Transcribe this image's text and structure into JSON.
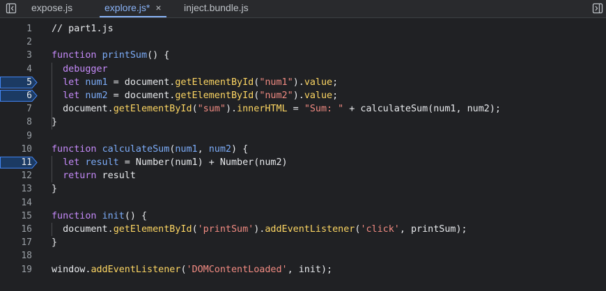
{
  "tabs": [
    {
      "label": "expose.js",
      "active": false
    },
    {
      "label": "explore.js*",
      "active": true,
      "close": "×"
    },
    {
      "label": "inject.bundle.js",
      "active": false
    }
  ],
  "colors": {
    "background": "#202124",
    "keyword": "#c58af9",
    "function": "#7cacf8",
    "property": "#fdd663",
    "string": "#f28b82",
    "breakpoint": "#1a73e8",
    "active_tab": "#8ab4f8"
  },
  "breakpoints": [
    5,
    6,
    11
  ],
  "lines": [
    {
      "n": "1",
      "t": [
        [
          "// part1.js",
          "cm"
        ]
      ]
    },
    {
      "n": "2",
      "t": []
    },
    {
      "n": "3",
      "t": [
        [
          "function",
          "kw"
        ],
        [
          " ",
          ""
        ],
        [
          "printSum",
          "fn"
        ],
        [
          "() {",
          ""
        ]
      ]
    },
    {
      "n": "4",
      "t": [
        [
          "  ",
          ""
        ],
        [
          "debugger",
          "kw"
        ]
      ]
    },
    {
      "n": "5",
      "t": [
        [
          "  ",
          ""
        ],
        [
          "let",
          "kw"
        ],
        [
          " ",
          ""
        ],
        [
          "num1",
          "var"
        ],
        [
          " = document.",
          ""
        ],
        [
          "getElementById",
          "prop"
        ],
        [
          "(",
          ""
        ],
        [
          "\"num1\"",
          "str"
        ],
        [
          ").",
          ""
        ],
        [
          "value",
          "prop"
        ],
        [
          ";",
          ""
        ]
      ]
    },
    {
      "n": "6",
      "t": [
        [
          "  ",
          ""
        ],
        [
          "let",
          "kw"
        ],
        [
          " ",
          ""
        ],
        [
          "num2",
          "var"
        ],
        [
          " = document.",
          ""
        ],
        [
          "getElementById",
          "prop"
        ],
        [
          "(",
          ""
        ],
        [
          "\"num2\"",
          "str"
        ],
        [
          ").",
          ""
        ],
        [
          "value",
          "prop"
        ],
        [
          ";",
          ""
        ]
      ]
    },
    {
      "n": "7",
      "t": [
        [
          "  document.",
          ""
        ],
        [
          "getElementById",
          "prop"
        ],
        [
          "(",
          ""
        ],
        [
          "\"sum\"",
          "str"
        ],
        [
          ").",
          ""
        ],
        [
          "innerHTML",
          "prop"
        ],
        [
          " = ",
          ""
        ],
        [
          "\"Sum: \"",
          "str"
        ],
        [
          " + calculateSum(num1, num2);",
          ""
        ]
      ]
    },
    {
      "n": "8",
      "t": [
        [
          "}",
          ""
        ]
      ]
    },
    {
      "n": "9",
      "t": []
    },
    {
      "n": "10",
      "t": [
        [
          "function",
          "kw"
        ],
        [
          " ",
          ""
        ],
        [
          "calculateSum",
          "fn"
        ],
        [
          "(",
          ""
        ],
        [
          "num1",
          "var"
        ],
        [
          ", ",
          ""
        ],
        [
          "num2",
          "var"
        ],
        [
          ") {",
          ""
        ]
      ]
    },
    {
      "n": "11",
      "t": [
        [
          "  ",
          ""
        ],
        [
          "let",
          "kw"
        ],
        [
          " ",
          ""
        ],
        [
          "result",
          "var"
        ],
        [
          " = Number(num1) + Number(num2)",
          ""
        ]
      ]
    },
    {
      "n": "12",
      "t": [
        [
          "  ",
          ""
        ],
        [
          "return",
          "kw"
        ],
        [
          " result",
          ""
        ]
      ]
    },
    {
      "n": "13",
      "t": [
        [
          "}",
          ""
        ]
      ]
    },
    {
      "n": "14",
      "t": []
    },
    {
      "n": "15",
      "t": [
        [
          "function",
          "kw"
        ],
        [
          " ",
          ""
        ],
        [
          "init",
          "fn"
        ],
        [
          "() {",
          ""
        ]
      ]
    },
    {
      "n": "16",
      "t": [
        [
          "  document.",
          ""
        ],
        [
          "getElementById",
          "prop"
        ],
        [
          "(",
          ""
        ],
        [
          "'printSum'",
          "str"
        ],
        [
          ").",
          ""
        ],
        [
          "addEventListener",
          "prop"
        ],
        [
          "(",
          ""
        ],
        [
          "'click'",
          "str"
        ],
        [
          ", printSum);",
          ""
        ]
      ]
    },
    {
      "n": "17",
      "t": [
        [
          "}",
          ""
        ]
      ]
    },
    {
      "n": "18",
      "t": []
    },
    {
      "n": "19",
      "t": [
        [
          "window.",
          ""
        ],
        [
          "addEventListener",
          "prop"
        ],
        [
          "(",
          ""
        ],
        [
          "'DOMContentLoaded'",
          "str"
        ],
        [
          ", init);",
          ""
        ]
      ]
    }
  ]
}
